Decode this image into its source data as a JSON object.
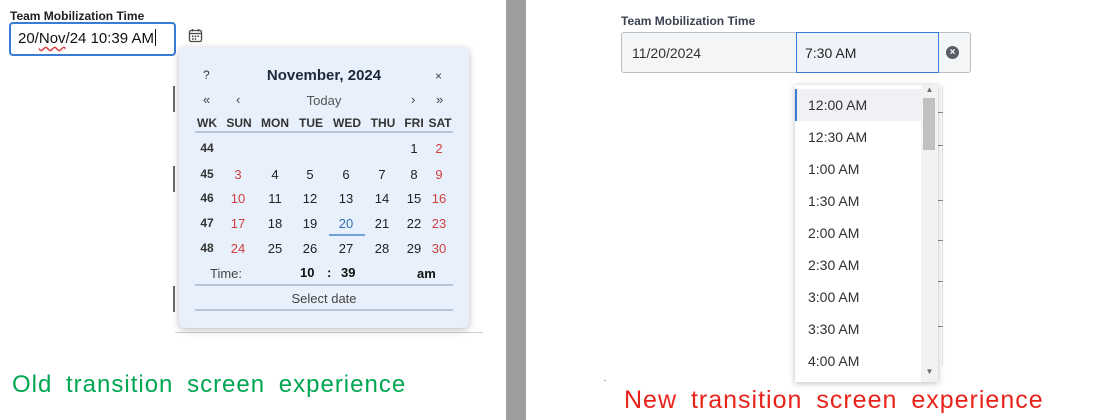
{
  "old": {
    "field_label": "Team Mobilization Time",
    "input": {
      "p1": "20/",
      "p2": "Nov",
      "p3": "/24 10:39 AM"
    },
    "calendar": {
      "help": "?",
      "title": "November, 2024",
      "close": "×",
      "nav": {
        "prev_year": "«",
        "prev_month": "‹",
        "today": "Today",
        "next_month": "›",
        "next_year": "»"
      },
      "headers": [
        "WK",
        "SUN",
        "MON",
        "TUE",
        "WED",
        "THU",
        "FRI",
        "SAT"
      ],
      "weeks": [
        {
          "wk": "44",
          "days": [
            "",
            "",
            "",
            "",
            "",
            "1",
            "2"
          ]
        },
        {
          "wk": "45",
          "days": [
            "3",
            "4",
            "5",
            "6",
            "7",
            "8",
            "9"
          ]
        },
        {
          "wk": "46",
          "days": [
            "10",
            "11",
            "12",
            "13",
            "14",
            "15",
            "16"
          ]
        },
        {
          "wk": "47",
          "days": [
            "17",
            "18",
            "19",
            "20",
            "21",
            "22",
            "23"
          ]
        },
        {
          "wk": "48",
          "days": [
            "24",
            "25",
            "26",
            "27",
            "28",
            "29",
            "30"
          ]
        }
      ],
      "time_label": "Time:",
      "hour": "10",
      "colon": ":",
      "minute": "39",
      "ampm": "am",
      "select_date": "Select date"
    },
    "caption": "Old transition screen experience",
    "caption_color": "#00a651"
  },
  "new": {
    "field_label": "Team Mobilization Time",
    "date_value": "11/20/2024",
    "time_value": "7:30 AM",
    "clear_icon": "clear-circle-x-icon",
    "options": [
      "12:00 AM",
      "12:30 AM",
      "1:00 AM",
      "1:30 AM",
      "2:00 AM",
      "2:30 AM",
      "3:00 AM",
      "3:30 AM",
      "4:00 AM"
    ],
    "highlighted_option": "12:00 AM",
    "scroll_up": "▲",
    "scroll_down": "▼",
    "caption": "New transition screen experience",
    "caption_color": "#e8231b"
  },
  "colors": {
    "accent": "#3a7bd5",
    "weekend": "#d04040",
    "calendar_bg": "#e8f1fb"
  }
}
